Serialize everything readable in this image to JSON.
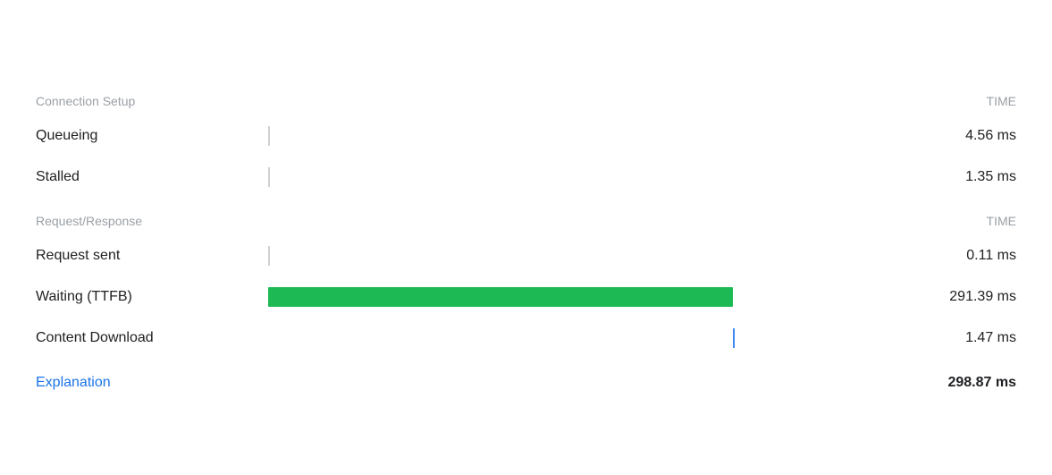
{
  "sections": {
    "connectionSetup": {
      "label": "Connection Setup",
      "timeLabel": "TIME",
      "rows": [
        {
          "id": "queueing",
          "label": "Queueing",
          "time": "4.56 ms",
          "barType": "divider"
        },
        {
          "id": "stalled",
          "label": "Stalled",
          "time": "1.35 ms",
          "barType": "divider"
        }
      ]
    },
    "requestResponse": {
      "label": "Request/Response",
      "timeLabel": "TIME",
      "rows": [
        {
          "id": "request-sent",
          "label": "Request sent",
          "time": "0.11 ms",
          "barType": "divider"
        },
        {
          "id": "waiting-ttfb",
          "label": "Waiting (TTFB)",
          "time": "291.39 ms",
          "barType": "green",
          "barWidth": 520,
          "barLeft": 0
        },
        {
          "id": "content-download",
          "label": "Content Download",
          "time": "1.47 ms",
          "barType": "blue-line",
          "lineLeft": 520
        }
      ]
    }
  },
  "footer": {
    "explanationLabel": "Explanation",
    "totalTime": "298.87 ms"
  },
  "colors": {
    "accent": "#1a73e8",
    "green": "#1db954",
    "blue": "#4285f4",
    "divider": "#d0d0d0",
    "sectionHeader": "#9aa0a6",
    "text": "#202124"
  }
}
